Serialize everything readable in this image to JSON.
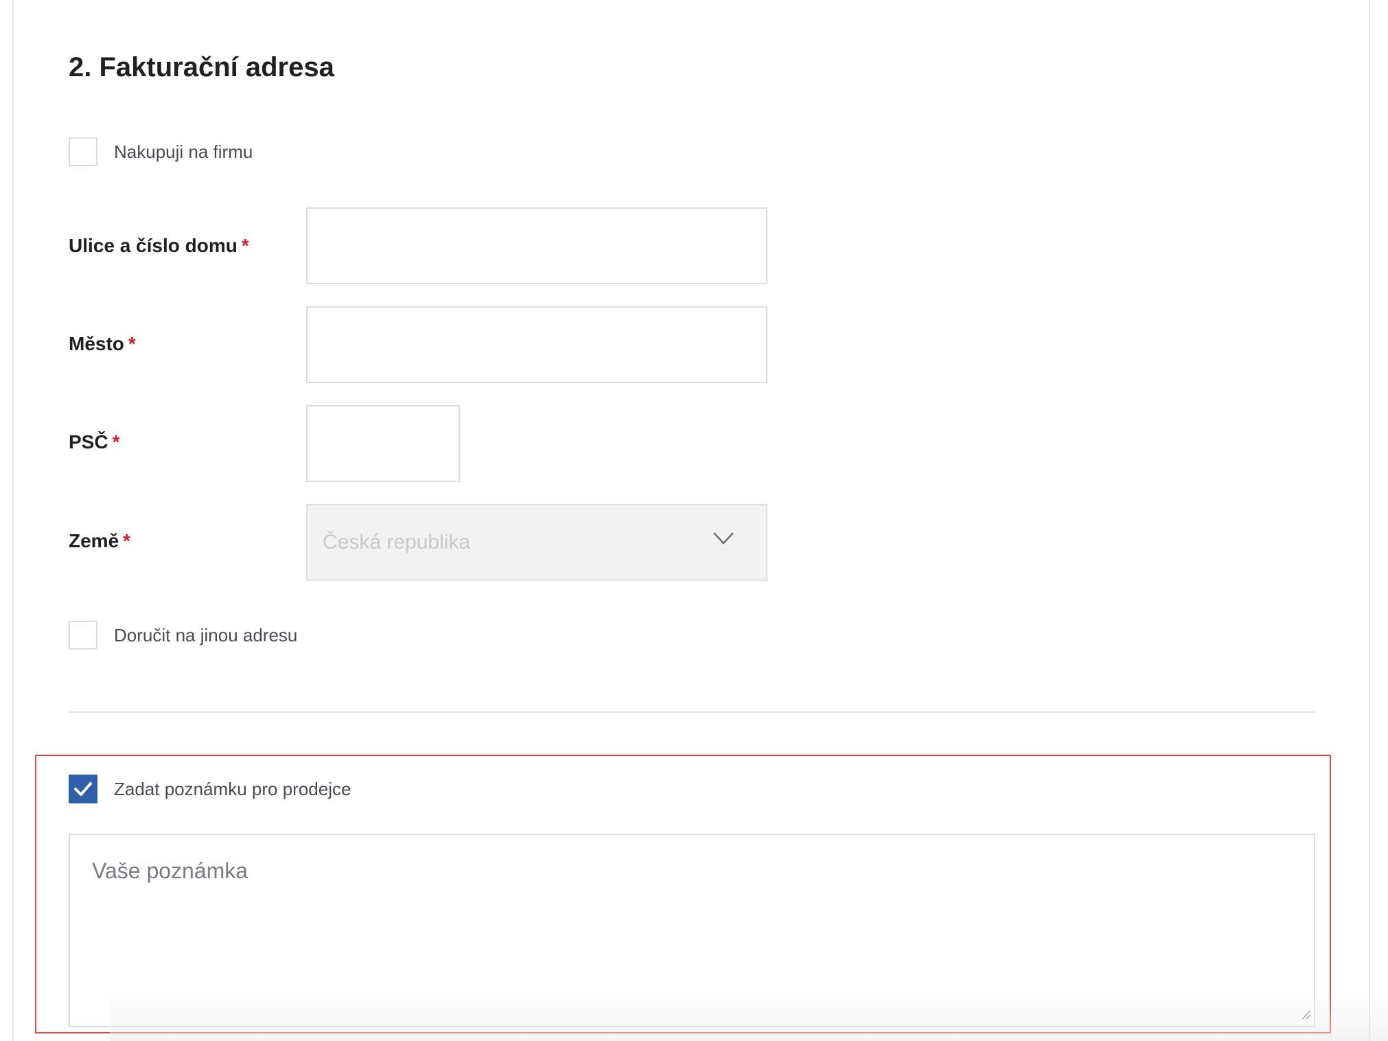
{
  "section": {
    "title": "2. Fakturační adresa"
  },
  "company_checkbox": {
    "label": "Nakupuji na firmu",
    "checked": false
  },
  "fields": {
    "street": {
      "label": "Ulice a číslo domu",
      "required_mark": "*",
      "value": ""
    },
    "city": {
      "label": "Město",
      "required_mark": "*",
      "value": ""
    },
    "zip": {
      "label": "PSČ",
      "required_mark": "*",
      "value": ""
    },
    "country": {
      "label": "Země",
      "required_mark": "*",
      "value": "Česká republika"
    }
  },
  "other_address_checkbox": {
    "label": "Doručit na jinou adresu",
    "checked": false
  },
  "note_checkbox": {
    "label": "Zadat poznámku pro prodejce",
    "checked": true
  },
  "note": {
    "placeholder": "Vaše poznámka"
  },
  "colors": {
    "accent": "#2f5fa8",
    "required": "#d2202f",
    "highlight": "#e34a3a"
  },
  "icons": {
    "select_chevron": "chevron-down-icon",
    "check": "check-icon",
    "resize": "resize-handle-icon"
  }
}
